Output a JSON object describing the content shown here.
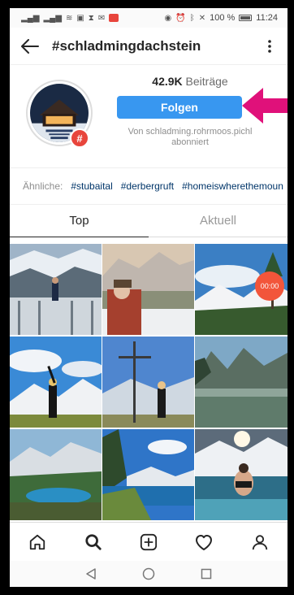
{
  "status_bar": {
    "battery": "100 %",
    "time": "11:24"
  },
  "app_bar": {
    "title": "#schladmingdachstein",
    "back_icon": "arrow-left-icon",
    "more_icon": "more-vertical-icon"
  },
  "header": {
    "posts_count": "42.9K",
    "posts_label": "Beiträge",
    "follow_label": "Folgen",
    "followed_by": "Von schladming.rohrmoos.pichl abonniert",
    "hash_badge": "#",
    "accent_color": "#3897f0",
    "arrow_color": "#e0117a"
  },
  "related": {
    "label": "Ähnliche:",
    "tags": [
      "#stubaital",
      "#derbergruft",
      "#homeiswherethemoun"
    ]
  },
  "tabs": [
    {
      "label": "Top",
      "active": true
    },
    {
      "label": "Aktuell",
      "active": false
    }
  ],
  "grid": {
    "video_timer": "00:00"
  },
  "bottom_nav": [
    "home-icon",
    "search-icon",
    "add-post-icon",
    "heart-icon",
    "profile-icon"
  ],
  "system_nav": [
    "back-triangle-icon",
    "home-circle-icon",
    "recents-square-icon"
  ]
}
